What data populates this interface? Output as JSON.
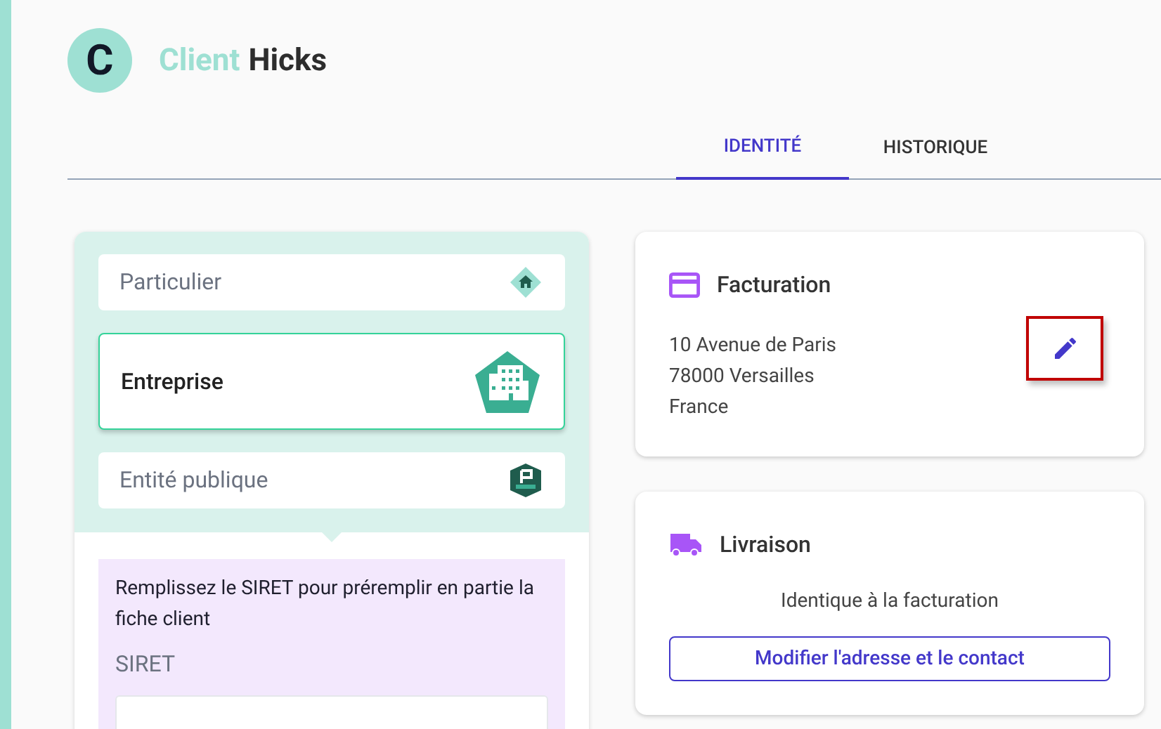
{
  "header": {
    "avatar_letter": "C",
    "title_prefix": "Client",
    "title_name": "Hicks"
  },
  "tabs": [
    {
      "label": "IDENTITÉ",
      "selected": true
    },
    {
      "label": "HISTORIQUE",
      "selected": false
    }
  ],
  "client_types": [
    {
      "kind": "person",
      "label": "Particulier",
      "selected": false
    },
    {
      "kind": "company",
      "label": "Entreprise",
      "selected": true
    },
    {
      "kind": "public",
      "label": "Entité publique",
      "selected": false
    }
  ],
  "siret_panel": {
    "hint": "Remplissez le SIRET pour préremplir en partie la fiche client",
    "label": "SIRET"
  },
  "billing": {
    "title": "Facturation",
    "address_lines": [
      "10 Avenue de Paris",
      "78000 Versailles",
      "France"
    ],
    "edit_highlighted": true
  },
  "delivery": {
    "title": "Livraison",
    "note": "Identique à la facturation",
    "button": "Modifier l'adresse et le contact"
  }
}
